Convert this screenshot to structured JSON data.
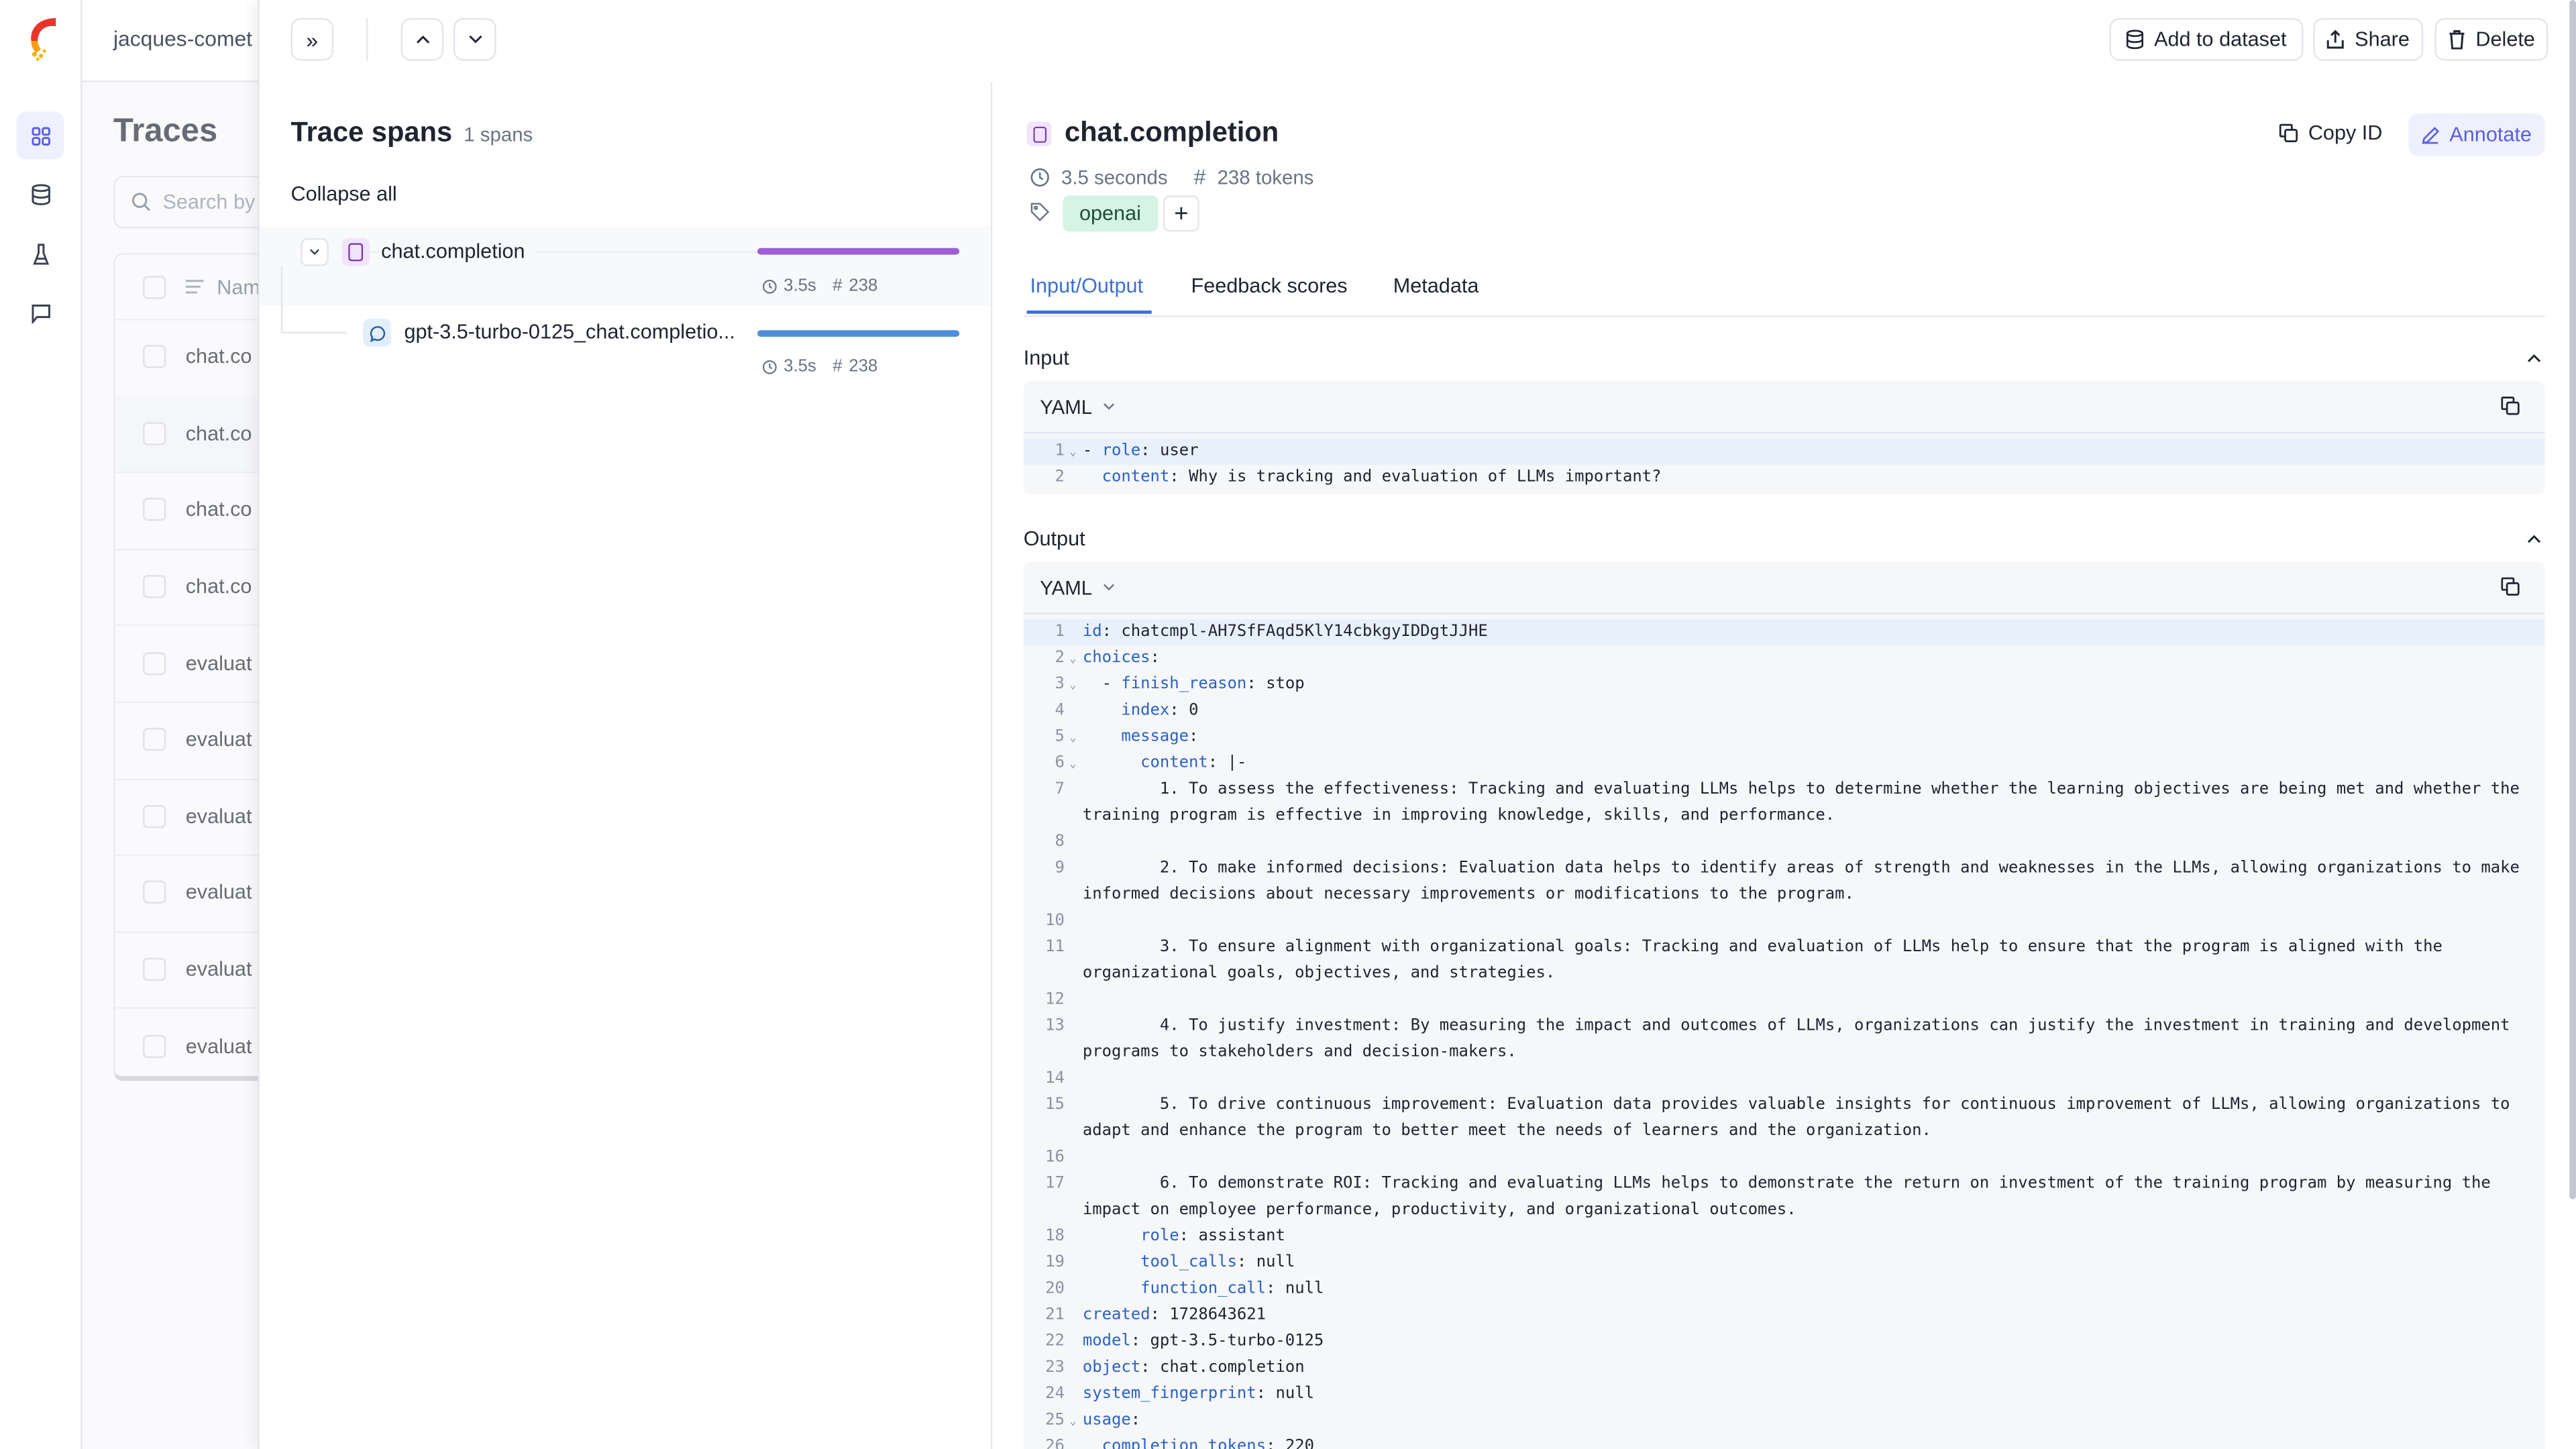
{
  "workspace": "jacques-comet",
  "nav": {
    "items": [
      "traces",
      "datasets",
      "experiments",
      "feedback"
    ],
    "active": "traces"
  },
  "traces_page": {
    "title": "Traces",
    "search_placeholder": "Search by",
    "column_name": "Name",
    "rows": [
      "chat.co",
      "chat.co",
      "chat.co",
      "chat.co",
      "evaluat",
      "evaluat",
      "evaluat",
      "evaluat",
      "evaluat",
      "evaluat"
    ]
  },
  "toolbar": {
    "add_to_dataset": "Add to dataset",
    "share": "Share",
    "delete": "Delete"
  },
  "spans": {
    "title": "Trace spans",
    "count": "1 spans",
    "collapse_all": "Collapse all",
    "items": [
      {
        "name": "chat.completion",
        "duration": "3.5s",
        "tokens": "238",
        "bar_color": "#9b5fd3",
        "bar_fill": 1.0
      },
      {
        "name": "gpt-3.5-turbo-0125_chat.completio...",
        "duration": "3.5s",
        "tokens": "238",
        "bar_color": "#4d8fdb",
        "bar_fill": 1.0
      }
    ]
  },
  "detail": {
    "title": "chat.completion",
    "copy_id": "Copy ID",
    "annotate": "Annotate",
    "duration": "3.5 seconds",
    "tokens": "238 tokens",
    "tag": "openai",
    "tabs": [
      "Input/Output",
      "Feedback scores",
      "Metadata"
    ],
    "active_tab": "Input/Output",
    "input": {
      "label": "Input",
      "format": "YAML",
      "lines": [
        {
          "n": "1",
          "fold": true,
          "pre": "- ",
          "key": "role",
          "val": "user"
        },
        {
          "n": "2",
          "fold": false,
          "pre": "  ",
          "key": "content",
          "val": "Why is tracking and evaluation of LLMs important?"
        }
      ]
    },
    "output": {
      "label": "Output",
      "format": "YAML",
      "lines": [
        {
          "n": "1",
          "fold": false,
          "pre": "",
          "key": "id",
          "val": "chatcmpl-AH7SfFAqd5KlY14cbkgyIDDgtJJHE"
        },
        {
          "n": "2",
          "fold": true,
          "pre": "",
          "key": "choices",
          "val": ""
        },
        {
          "n": "3",
          "fold": true,
          "pre": "  - ",
          "key": "finish_reason",
          "val": "stop"
        },
        {
          "n": "4",
          "fold": false,
          "pre": "    ",
          "key": "index",
          "val": "0"
        },
        {
          "n": "5",
          "fold": true,
          "pre": "    ",
          "key": "message",
          "val": ""
        },
        {
          "n": "6",
          "fold": true,
          "pre": "      ",
          "key": "content",
          "val": "|-"
        },
        {
          "n": "7",
          "fold": false,
          "text": "        1. To assess the effectiveness: Tracking and evaluating LLMs helps to determine whether the learning objectives are being met and whether the training program is effective in improving knowledge, skills, and performance."
        },
        {
          "n": "8",
          "fold": false,
          "text": ""
        },
        {
          "n": "9",
          "fold": false,
          "text": "        2. To make informed decisions: Evaluation data helps to identify areas of strength and weaknesses in the LLMs, allowing organizations to make informed decisions about necessary improvements or modifications to the program."
        },
        {
          "n": "10",
          "fold": false,
          "text": ""
        },
        {
          "n": "11",
          "fold": false,
          "text": "        3. To ensure alignment with organizational goals: Tracking and evaluation of LLMs help to ensure that the program is aligned with the organizational goals, objectives, and strategies."
        },
        {
          "n": "12",
          "fold": false,
          "text": ""
        },
        {
          "n": "13",
          "fold": false,
          "text": "        4. To justify investment: By measuring the impact and outcomes of LLMs, organizations can justify the investment in training and development programs to stakeholders and decision-makers."
        },
        {
          "n": "14",
          "fold": false,
          "text": ""
        },
        {
          "n": "15",
          "fold": false,
          "text": "        5. To drive continuous improvement: Evaluation data provides valuable insights for continuous improvement of LLMs, allowing organizations to adapt and enhance the program to better meet the needs of learners and the organization."
        },
        {
          "n": "16",
          "fold": false,
          "text": ""
        },
        {
          "n": "17",
          "fold": false,
          "text": "        6. To demonstrate ROI: Tracking and evaluating LLMs helps to demonstrate the return on investment of the training program by measuring the impact on employee performance, productivity, and organizational outcomes."
        },
        {
          "n": "18",
          "fold": false,
          "pre": "      ",
          "key": "role",
          "val": "assistant"
        },
        {
          "n": "19",
          "fold": false,
          "pre": "      ",
          "key": "tool_calls",
          "val": "null"
        },
        {
          "n": "20",
          "fold": false,
          "pre": "      ",
          "key": "function_call",
          "val": "null"
        },
        {
          "n": "21",
          "fold": false,
          "pre": "",
          "key": "created",
          "val": "1728643621"
        },
        {
          "n": "22",
          "fold": false,
          "pre": "",
          "key": "model",
          "val": "gpt-3.5-turbo-0125"
        },
        {
          "n": "23",
          "fold": false,
          "pre": "",
          "key": "object",
          "val": "chat.completion"
        },
        {
          "n": "24",
          "fold": false,
          "pre": "",
          "key": "system_fingerprint",
          "val": "null"
        },
        {
          "n": "25",
          "fold": true,
          "pre": "",
          "key": "usage",
          "val": ""
        },
        {
          "n": "26",
          "fold": false,
          "pre": "  ",
          "key": "completion_tokens",
          "val": "220"
        }
      ]
    }
  },
  "colors": {
    "accent": "#5b5fe0",
    "tab_active": "#3d6fd8",
    "tag_bg": "#d5f3e6",
    "span_llm": "#9b5fd3",
    "span_chat": "#4d8fdb"
  }
}
